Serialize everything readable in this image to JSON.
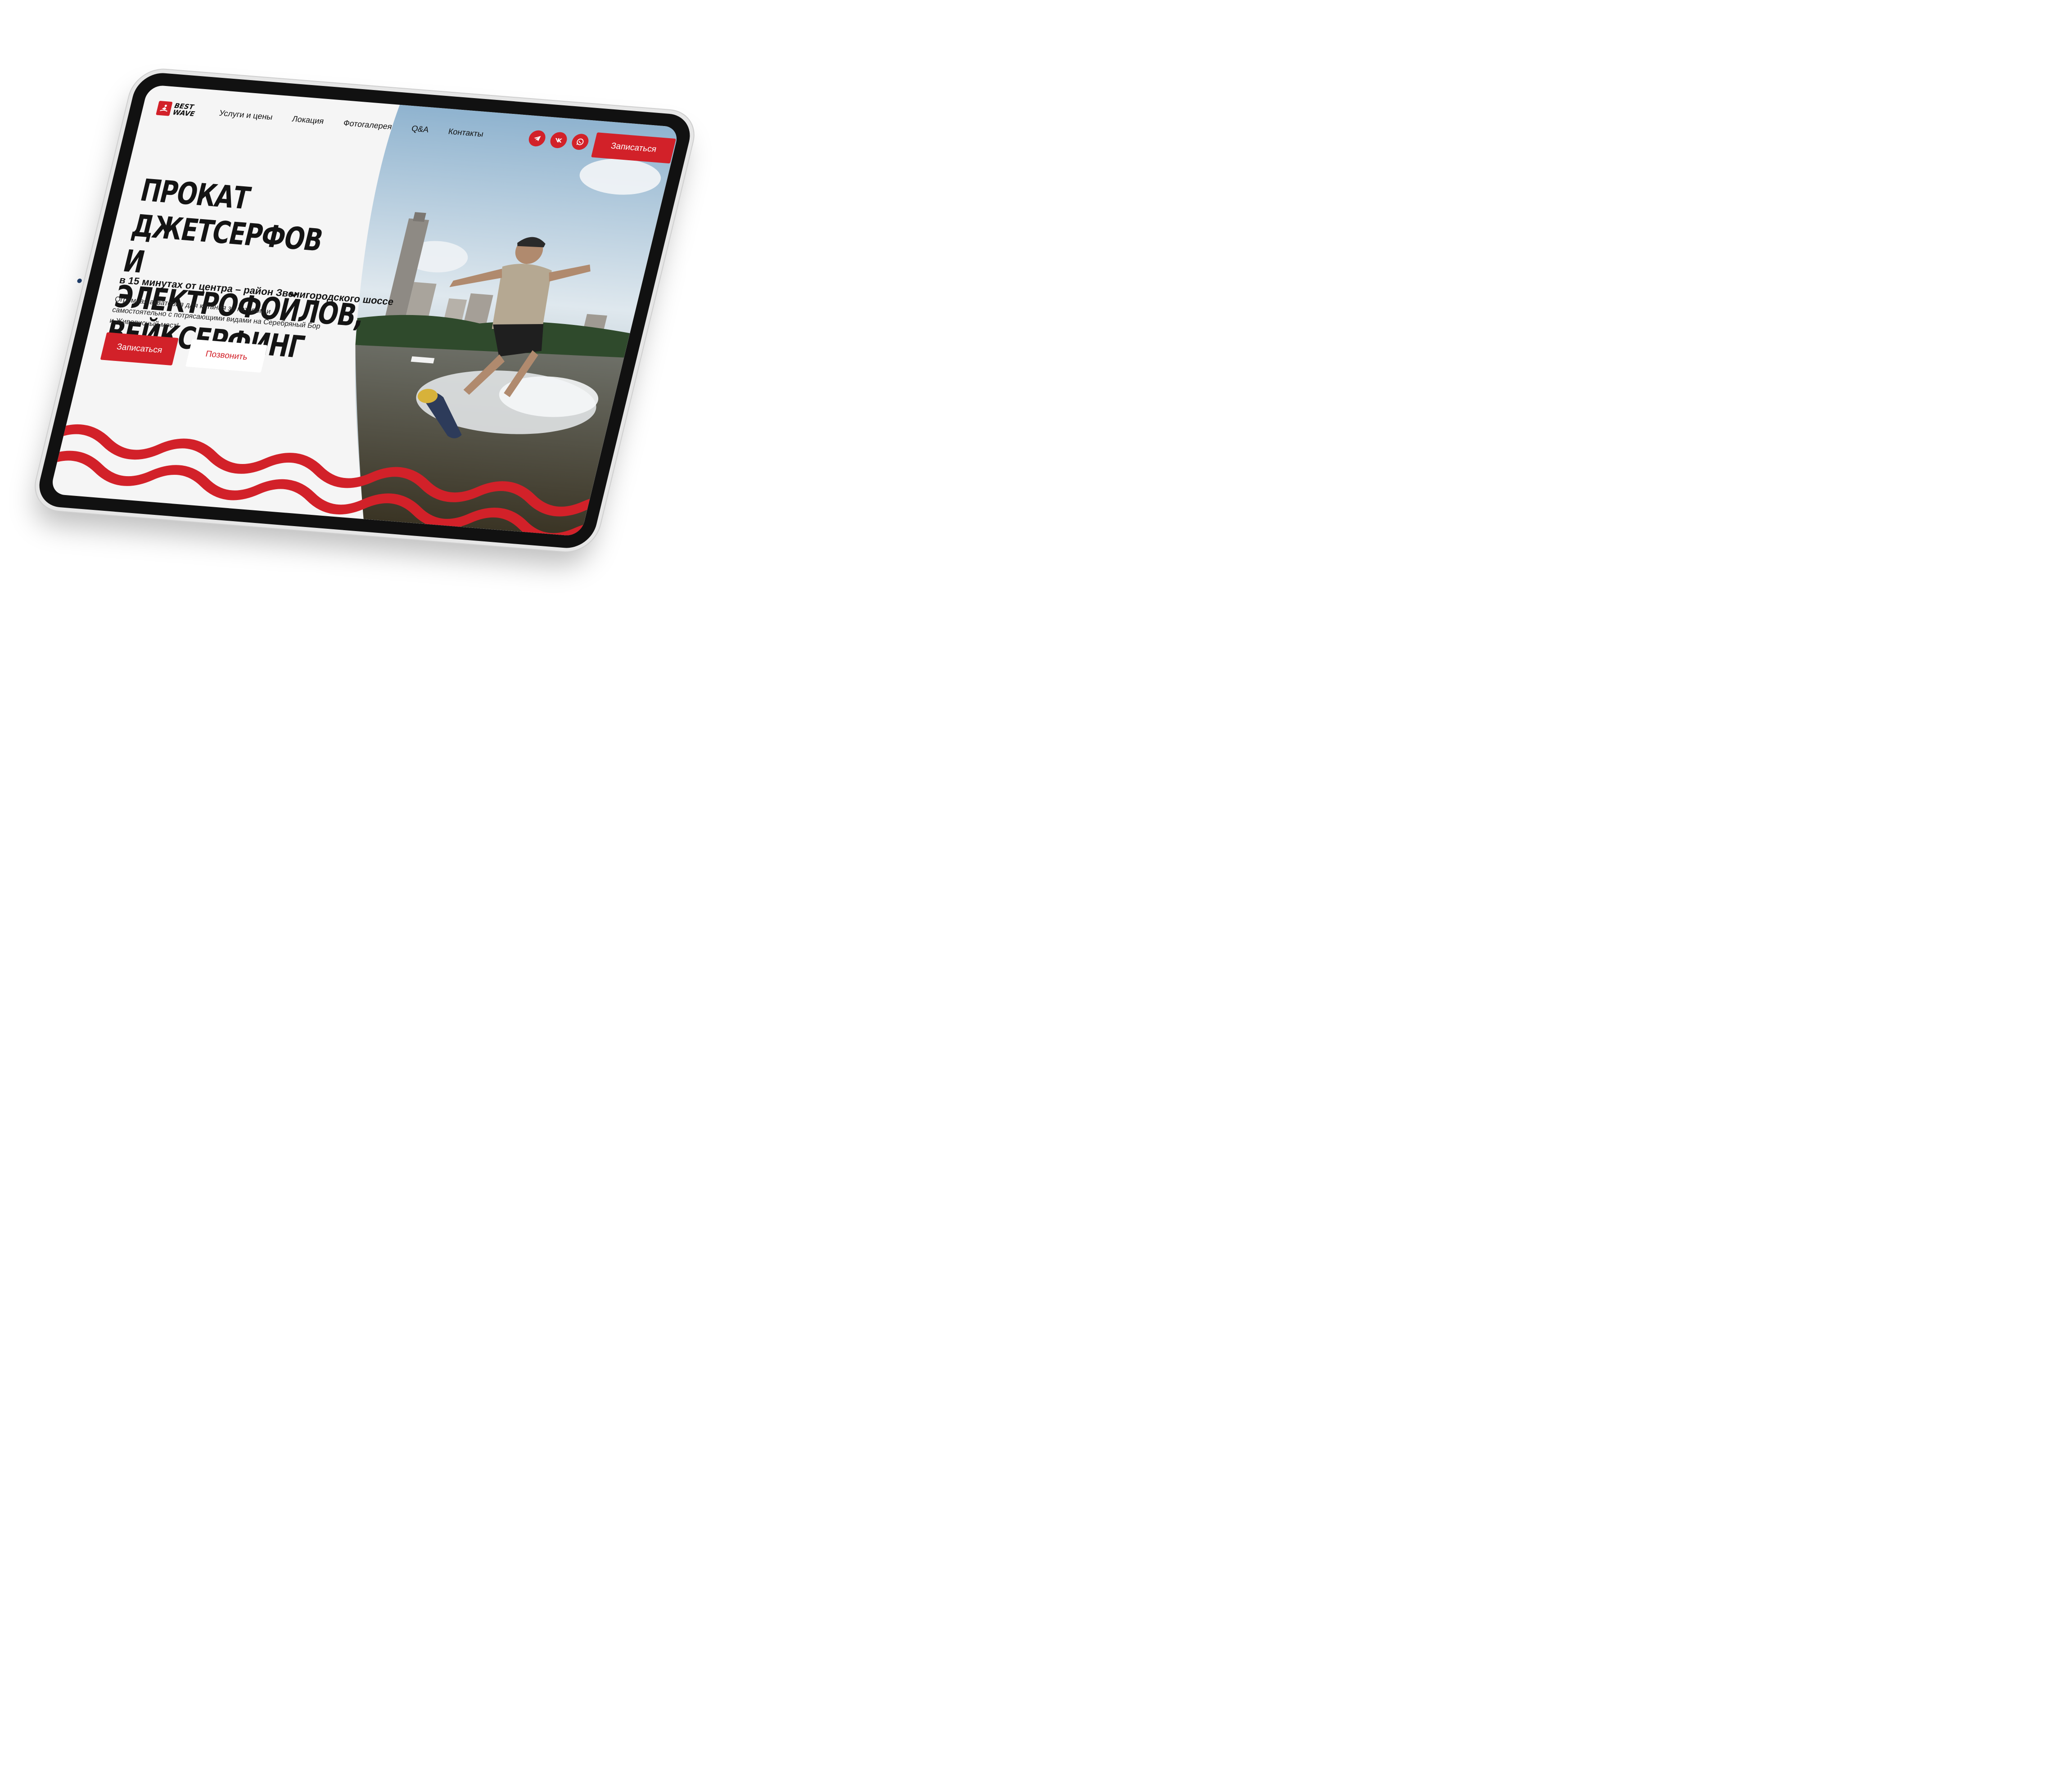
{
  "logo": {
    "text_line1": "BEST",
    "text_line2": "WAVE"
  },
  "nav": {
    "items": [
      {
        "label": "Услуги и цены"
      },
      {
        "label": "Локация"
      },
      {
        "label": "Фотогалерея"
      },
      {
        "label": "Q&A"
      },
      {
        "label": "Контакты"
      }
    ]
  },
  "socials": [
    {
      "icon": "telegram-icon"
    },
    {
      "icon": "vk-icon"
    },
    {
      "icon": "whatsapp-icon"
    }
  ],
  "header": {
    "cta_label": "Записаться"
  },
  "hero": {
    "title": "ПРОКАТ ДЖЕТСЕРФОВ\nИ ЭЛЕКТРОФОЙЛОВ,\nВЕЙКСЕРФИНГ",
    "subtitle": "в 15 минутах от центра – район Звенигородского шоссе",
    "description": "Огромная акватория для катания за катером и самостоятельно с потрясающими видами на Серебряный Бор и Живописный мост!",
    "primary_button": "Записаться",
    "secondary_button": "Позвонить"
  },
  "colors": {
    "accent": "#d22129",
    "text": "#141414",
    "background": "#f5f5f5"
  }
}
